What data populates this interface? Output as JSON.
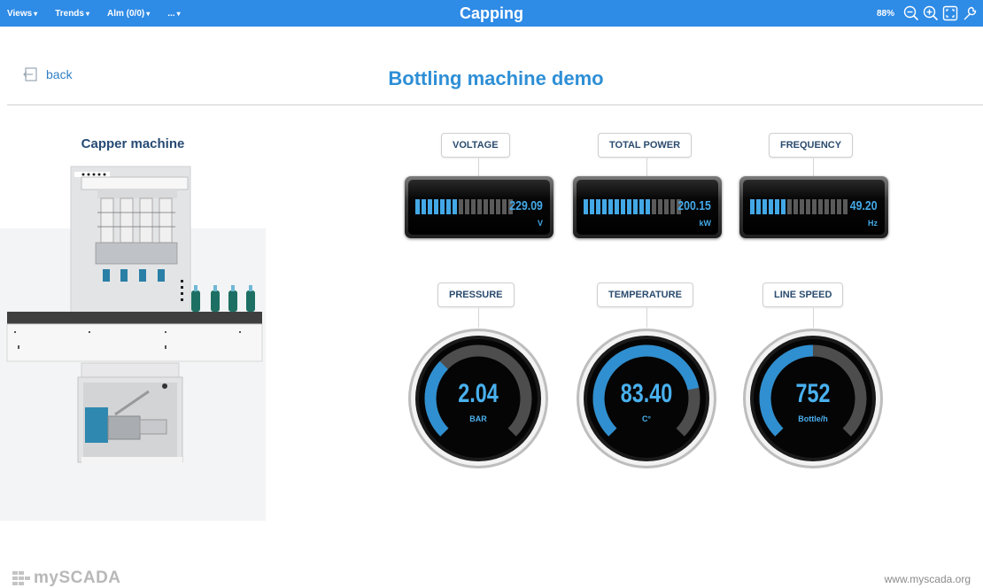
{
  "topbar": {
    "menu": [
      {
        "label": "Views"
      },
      {
        "label": "Trends"
      },
      {
        "label": "Alm (0/0)"
      },
      {
        "label": "..."
      }
    ],
    "title": "Capping",
    "zoom": "88%",
    "bg_color": "#2e8be6"
  },
  "header": {
    "back_label": "back",
    "title": "Bottling machine demo"
  },
  "machine": {
    "title": "Capper machine"
  },
  "bar_meters": [
    {
      "label": "VOLTAGE",
      "value": "229.09",
      "unit": "V",
      "lit_segments": 7,
      "total_segments": 16
    },
    {
      "label": "TOTAL POWER",
      "value": "200.15",
      "unit": "kW",
      "lit_segments": 11,
      "total_segments": 16
    },
    {
      "label": "FREQUENCY",
      "value": "49.20",
      "unit": "Hz",
      "lit_segments": 6,
      "total_segments": 16
    }
  ],
  "gauges": [
    {
      "label": "PRESSURE",
      "value": "2.04",
      "unit": "BAR",
      "fill_fraction": 0.33
    },
    {
      "label": "TEMPERATURE",
      "value": "83.40",
      "unit": "C°",
      "fill_fraction": 0.79
    },
    {
      "label": "LINE SPEED",
      "value": "752",
      "unit": "Bottle/h",
      "fill_fraction": 0.5
    }
  ],
  "colors": {
    "accent": "#43a8e6",
    "title_blue": "#2e8fd6",
    "label_text": "#2a4b6e"
  },
  "footer": {
    "logo_text": "mySCADA",
    "url": "www.myscada.org"
  }
}
